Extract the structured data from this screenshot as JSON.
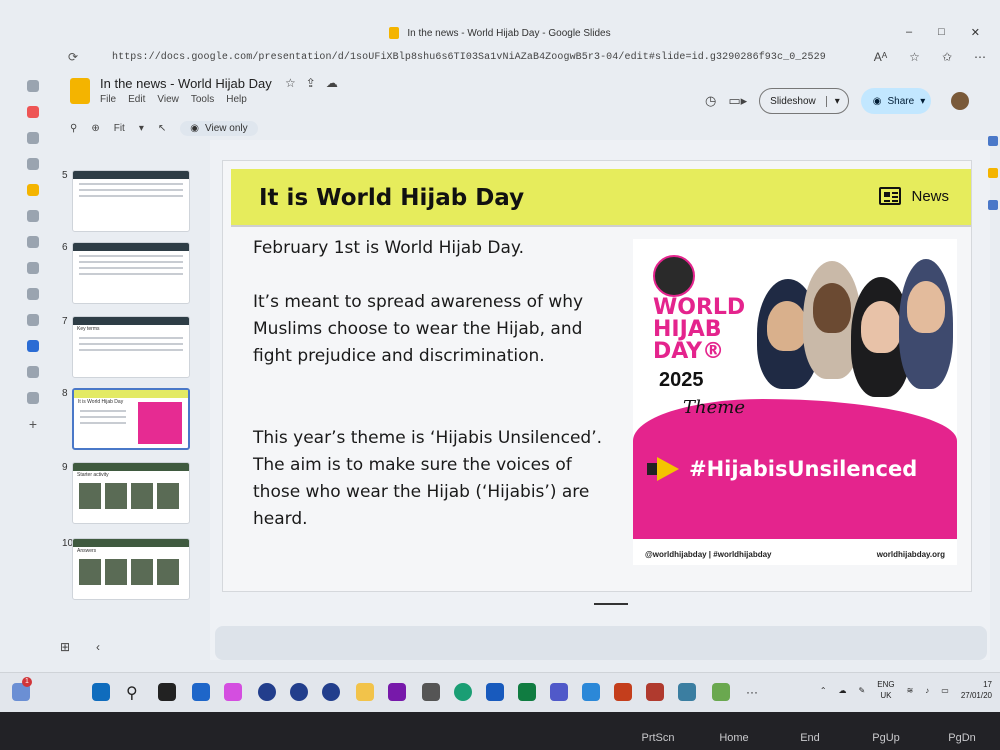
{
  "browser": {
    "window_title": "In the news - World Hijab Day - Google Slides",
    "url": "https://docs.google.com/presentation/d/1soUFiXBlp8shu6s6TI03Sa1vNiAZaB4ZoogwB5r3-04/edit#slide=id.g3290286f93c_0_2529",
    "controls": [
      "–",
      "□",
      "✕"
    ]
  },
  "docs": {
    "title": "In the news - World Hijab Day",
    "menus": [
      "File",
      "Edit",
      "View",
      "Tools",
      "Help"
    ],
    "slideshow_label": "Slideshow",
    "share_label": "Share",
    "zoom_label": "Fit",
    "view_only_label": "View only"
  },
  "filmstrip": [
    {
      "num": "5",
      "style": "dark"
    },
    {
      "num": "6",
      "style": "dark"
    },
    {
      "num": "7",
      "style": "table",
      "label": "Key terms"
    },
    {
      "num": "8",
      "style": "active",
      "label": "It is World Hijab Day"
    },
    {
      "num": "9",
      "style": "pics",
      "label": "Starter activity"
    },
    {
      "num": "10",
      "style": "pics",
      "label": "Answers"
    }
  ],
  "slide": {
    "title": "It is World Hijab Day",
    "tag": "News",
    "p1": "February 1st is World Hijab Day.",
    "p2": "It’s meant to spread awareness of why Muslims choose to wear the Hijab, and fight prejudice and discrimination.",
    "p3": "This year’s theme is ‘Hijabis Unsilenced’. The aim is to make sure the voices of those who wear the Hijab (‘Hijabis’) are heard."
  },
  "poster": {
    "title": "WORLD HIJAB DAY®",
    "year": "2025",
    "theme": "Theme",
    "hashtag": "#HijabisUnsilenced",
    "handle": "@worldhijabday | #worldhijabday",
    "site": "worldhijabday.org"
  },
  "taskbar": {
    "badge": "1",
    "lang": "ENG",
    "region": "UK",
    "time": "17",
    "date": "27/01/20",
    "more": "···"
  },
  "keyboard": [
    "PrtScn",
    "Home",
    "End",
    "PgUp",
    "PgDn"
  ],
  "colors": {
    "header_yellow": "#e6ec5c",
    "poster_pink": "#e4248d",
    "share_blue": "#c2e7ff"
  }
}
